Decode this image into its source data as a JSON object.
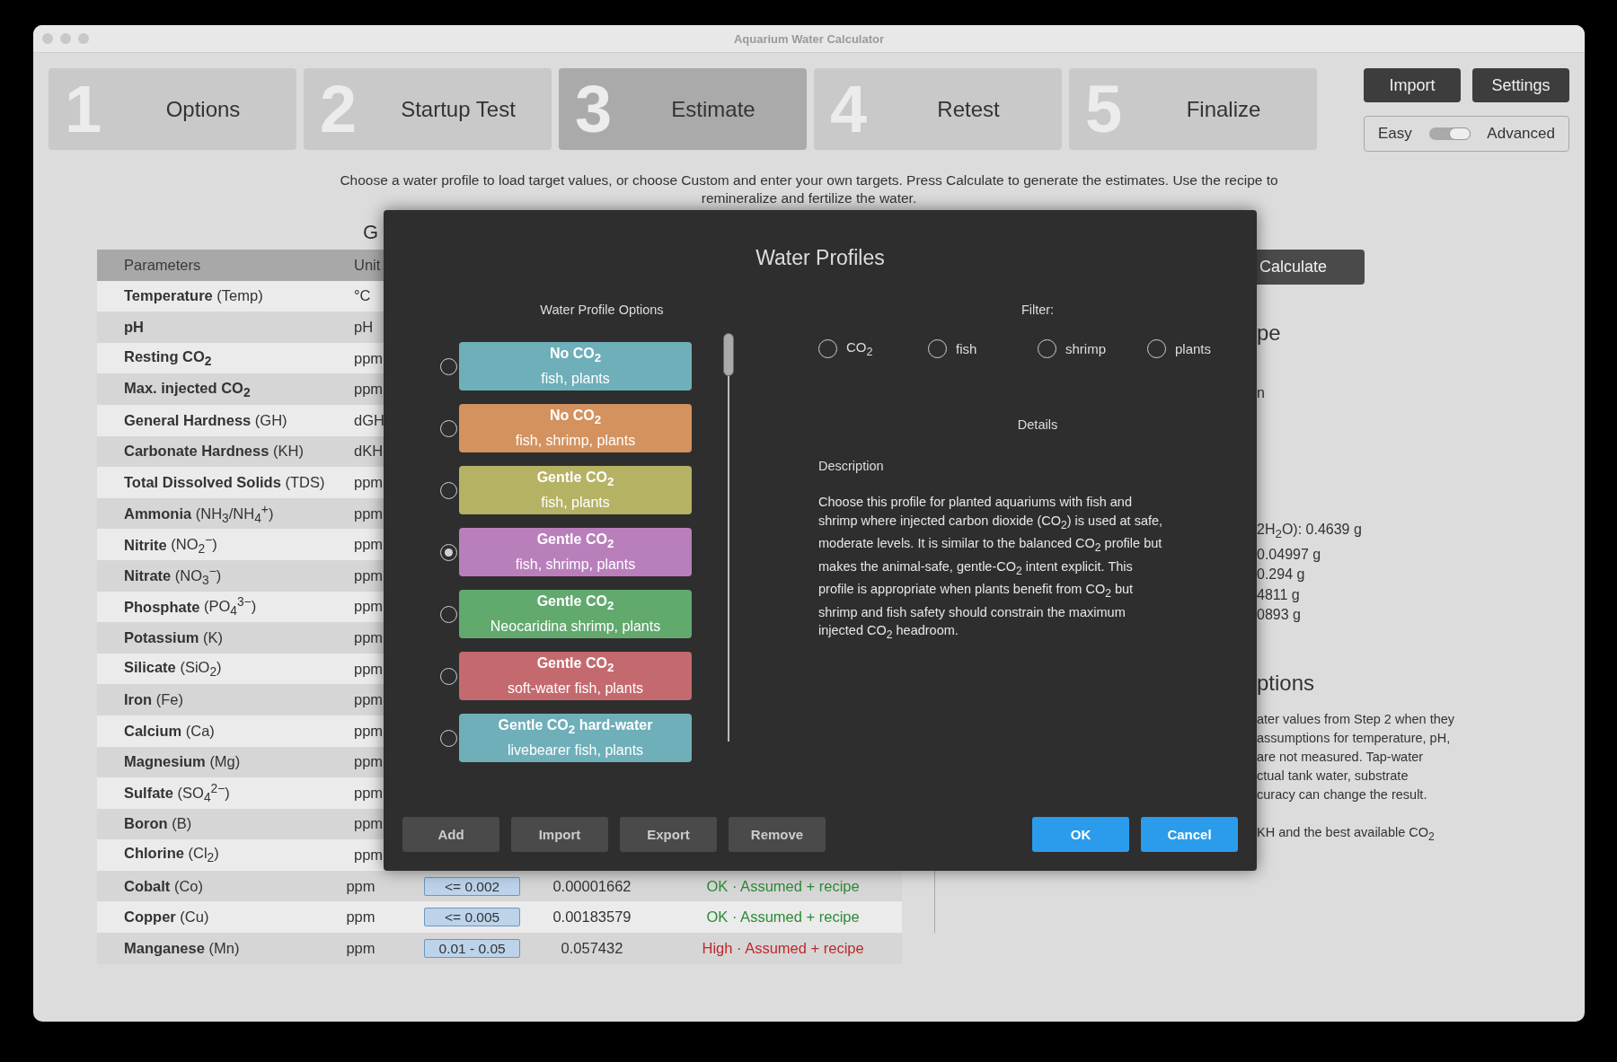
{
  "window": {
    "title": "Aquarium Water Calculator"
  },
  "steps": [
    {
      "number": "1",
      "label": "Options",
      "selected": false
    },
    {
      "number": "2",
      "label": "Startup Test",
      "selected": false
    },
    {
      "number": "3",
      "label": "Estimate",
      "selected": true
    },
    {
      "number": "4",
      "label": "Retest",
      "selected": false
    },
    {
      "number": "5",
      "label": "Finalize",
      "selected": false
    }
  ],
  "header_buttons": [
    "Import",
    "Settings"
  ],
  "mode_toggle": {
    "left_label": "Easy",
    "right_label": "Advanced",
    "on": true
  },
  "instruction": "Choose a water profile to load target values, or choose Custom and enter your own targets. Press Calculate to generate the estimates. Use the recipe to remineralize and fertilize the water.",
  "left_heading": "G",
  "table": {
    "columns": [
      "Parameters",
      "Unit"
    ],
    "rows": [
      {
        "name": "Temperature",
        "formula": "(Temp)",
        "unit": "°C"
      },
      {
        "name": "pH",
        "formula": "",
        "unit": "pH"
      },
      {
        "name": "Resting CO$_{2}$",
        "formula": "",
        "unit": "ppm"
      },
      {
        "name": "Max. injected CO$_{2}$",
        "formula": "",
        "unit": "ppm"
      },
      {
        "name": "General Hardness",
        "formula": "(GH)",
        "unit": "dGH"
      },
      {
        "name": "Carbonate Hardness",
        "formula": "(KH)",
        "unit": "dKH"
      },
      {
        "name": "Total Dissolved Solids",
        "formula": "(TDS)",
        "unit": "ppm"
      },
      {
        "name": "Ammonia",
        "formula": "(NH$_{3}$/NH$_{4}$$^{+}$)",
        "unit": "ppm"
      },
      {
        "name": "Nitrite",
        "formula": "(NO$_{2}$$^{−}$)",
        "unit": "ppm"
      },
      {
        "name": "Nitrate",
        "formula": "(NO$_{3}$$^{−}$)",
        "unit": "ppm"
      },
      {
        "name": "Phosphate",
        "formula": "(PO$_{4}$$^{3−}$)",
        "unit": "ppm"
      },
      {
        "name": "Potassium",
        "formula": "(K)",
        "unit": "ppm"
      },
      {
        "name": "Silicate",
        "formula": "(SiO$_{2}$)",
        "unit": "ppm"
      },
      {
        "name": "Iron",
        "formula": "(Fe)",
        "unit": "ppm"
      },
      {
        "name": "Calcium",
        "formula": "(Ca)",
        "unit": "ppm"
      },
      {
        "name": "Magnesium",
        "formula": "(Mg)",
        "unit": "ppm"
      },
      {
        "name": "Sulfate",
        "formula": "(SO$_{4}$$^{2−}$)",
        "unit": "ppm"
      },
      {
        "name": "Boron",
        "formula": "(B)",
        "unit": "ppm"
      },
      {
        "name": "Chlorine",
        "formula": "(Cl$_{2}$)",
        "unit": "ppm"
      },
      {
        "name": "Cobalt",
        "formula": "(Co)",
        "unit": "ppm",
        "target": "<= 0.002",
        "value": "0.00001662",
        "status": "OK · Assumed + recipe",
        "kind": "ok"
      },
      {
        "name": "Copper",
        "formula": "(Cu)",
        "unit": "ppm",
        "target": "<= 0.005",
        "value": "0.00183579",
        "status": "OK · Assumed + recipe",
        "kind": "ok"
      },
      {
        "name": "Manganese",
        "formula": "(Mn)",
        "unit": "ppm",
        "target": "0.01 - 0.05",
        "value": "0.057432",
        "status": "High · Assumed + recipe",
        "kind": "high"
      }
    ]
  },
  "right_panel": {
    "calculate_button": "Calculate",
    "recipe_heading": "pe",
    "recipe_note": "n",
    "recipe_lines": [
      "2H$_{2}$O): 0.4639 g",
      "0.04997 g",
      "0.294 g",
      "4811 g",
      "0893 g"
    ],
    "assumptions_heading": "ptions",
    "assumptions_lines": [
      "ater values from Step 2 when they",
      "assumptions for temperature, pH,",
      "are not measured. Tap-water",
      "ctual tank water, substrate",
      "curacy can change the result."
    ],
    "assumptions_note": "KH and the best available CO$_{2}$"
  },
  "dialog": {
    "title": "Water Profiles",
    "options_label": "Water Profile Options",
    "profiles": [
      {
        "title": "No CO$_{2}$",
        "subtitle": "fish, plants",
        "color": "#6eafb9",
        "selected": false
      },
      {
        "title": "No CO$_{2}$",
        "subtitle": "fish, shrimp, plants",
        "color": "#d4925f",
        "selected": false
      },
      {
        "title": "Gentle CO$_{2}$",
        "subtitle": "fish, plants",
        "color": "#b5b264",
        "selected": false
      },
      {
        "title": "Gentle CO$_{2}$",
        "subtitle": "fish, shrimp, plants",
        "color": "#b97fbb",
        "selected": true
      },
      {
        "title": "Gentle CO$_{2}$",
        "subtitle": "Neocaridina shrimp, plants",
        "color": "#62a96e",
        "selected": false
      },
      {
        "title": "Gentle CO$_{2}$",
        "subtitle": "soft-water fish, plants",
        "color": "#c46a6f",
        "selected": false
      },
      {
        "title": "Gentle CO$_{2}$ hard-water",
        "subtitle": "livebearer fish, plants",
        "color": "#6eafb9",
        "selected": false
      }
    ],
    "filter_label": "Filter:",
    "filters": [
      {
        "label": "CO$_{2}$",
        "checked": false
      },
      {
        "label": "fish",
        "checked": false
      },
      {
        "label": "shrimp",
        "checked": false
      },
      {
        "label": "plants",
        "checked": false
      }
    ],
    "details_label": "Details",
    "description_label": "Description",
    "description": "Choose this profile for planted aquariums with fish and shrimp where injected carbon dioxide (CO$_{2}$) is used at safe, moderate levels. It is similar to the balanced CO$_{2}$ profile but makes the animal-safe, gentle-CO$_{2}$ intent explicit. This profile is appropriate when plants benefit from CO$_{2}$ but shrimp and fish safety should constrain the maximum injected CO$_{2}$ headroom.",
    "left_buttons": [
      "Add",
      "Import",
      "Export",
      "Remove"
    ],
    "right_buttons": [
      {
        "label": "OK",
        "kind": "primary"
      },
      {
        "label": "Cancel",
        "kind": "primary"
      }
    ]
  }
}
